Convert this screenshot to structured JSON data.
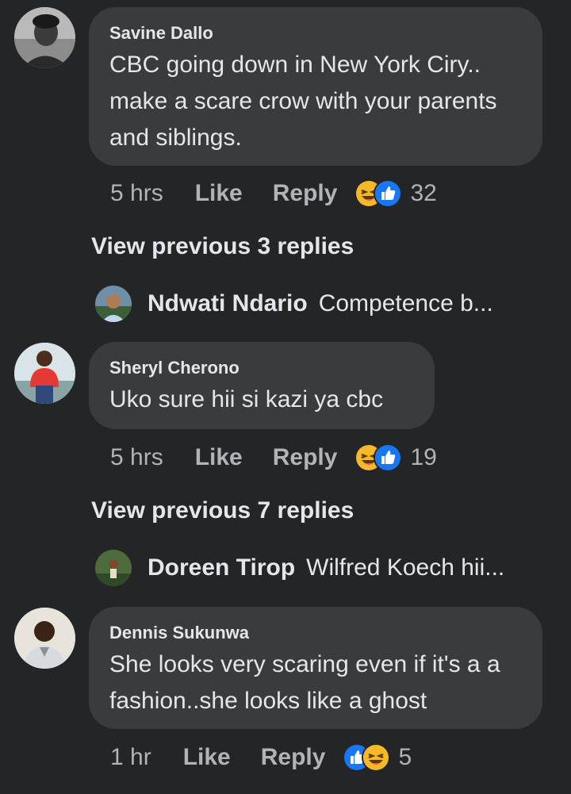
{
  "comments": [
    {
      "author": "Savine Dallo",
      "text": "CBC going down in New York Ciry.. make a scare crow with your parents and siblings.",
      "time": "5 hrs",
      "like": "Like",
      "reply": "Reply",
      "reactions": [
        "haha-icon",
        "like-icon"
      ],
      "count": "32",
      "view_previous": "View previous 3 replies",
      "reply_preview": {
        "name": "Ndwati Ndario",
        "snippet": "Competence b..."
      }
    },
    {
      "author": "Sheryl Cherono",
      "text": "Uko sure hii si kazi ya cbc",
      "time": "5 hrs",
      "like": "Like",
      "reply": "Reply",
      "reactions": [
        "haha-icon",
        "like-icon"
      ],
      "count": "19",
      "view_previous": "View previous 7 replies",
      "reply_preview": {
        "name": "Doreen Tirop",
        "snippet": "Wilfred Koech hii..."
      }
    },
    {
      "author": "Dennis Sukunwa",
      "text": "She looks very scaring even if it's a a fashion..she looks like a ghost",
      "time": "1 hr",
      "like": "Like",
      "reply": "Reply",
      "reactions": [
        "like-icon",
        "haha-icon"
      ],
      "count": "5"
    }
  ],
  "colors": {
    "background": "#242526",
    "bubble": "#3a3b3c",
    "primary_text": "#e4e6eb",
    "secondary_text": "#b0b3b8",
    "like_blue": "#1877f2",
    "haha_yellow": "#f7b928"
  }
}
